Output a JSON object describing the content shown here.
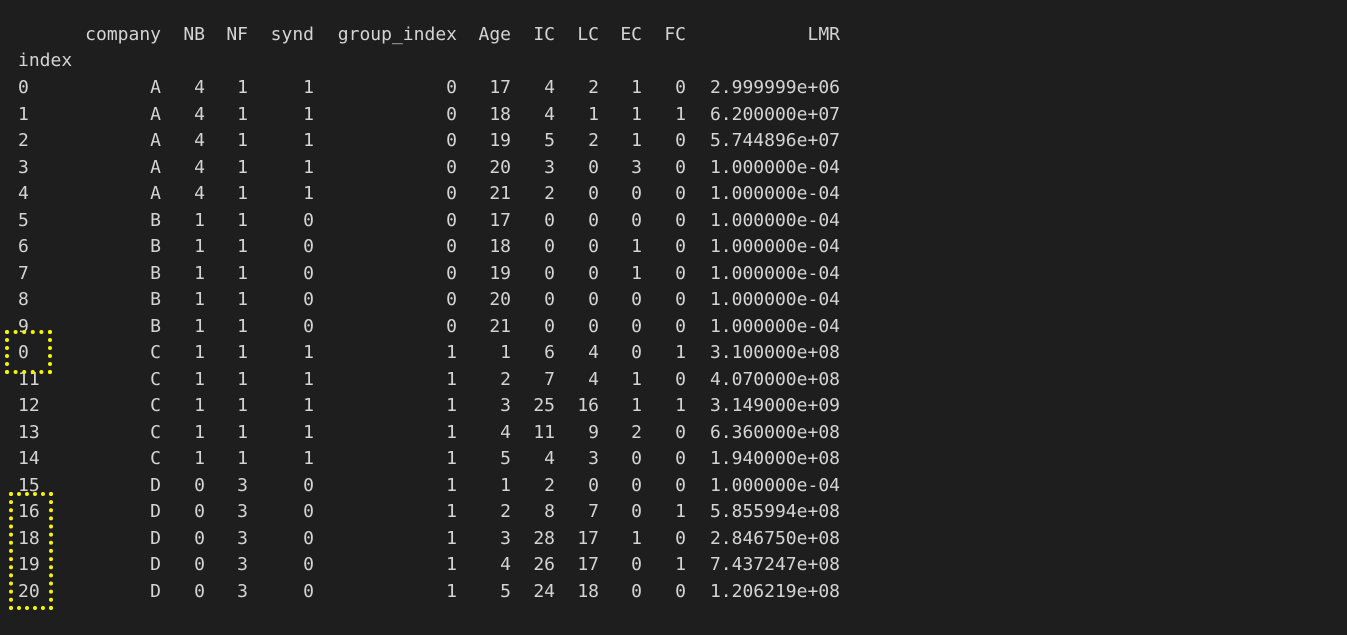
{
  "output": {
    "columns": [
      "company",
      "NB",
      "NF",
      "synd",
      "group_index",
      "Age",
      "IC",
      "LC",
      "EC",
      "FC",
      "LMR"
    ],
    "index_label": "index",
    "rows": [
      {
        "index": "0",
        "company": "A",
        "NB": "4",
        "NF": "1",
        "synd": "1",
        "group_index": "0",
        "Age": "17",
        "IC": "4",
        "LC": "2",
        "EC": "1",
        "FC": "0",
        "LMR": "2.999999e+06"
      },
      {
        "index": "1",
        "company": "A",
        "NB": "4",
        "NF": "1",
        "synd": "1",
        "group_index": "0",
        "Age": "18",
        "IC": "4",
        "LC": "1",
        "EC": "1",
        "FC": "1",
        "LMR": "6.200000e+07"
      },
      {
        "index": "2",
        "company": "A",
        "NB": "4",
        "NF": "1",
        "synd": "1",
        "group_index": "0",
        "Age": "19",
        "IC": "5",
        "LC": "2",
        "EC": "1",
        "FC": "0",
        "LMR": "5.744896e+07"
      },
      {
        "index": "3",
        "company": "A",
        "NB": "4",
        "NF": "1",
        "synd": "1",
        "group_index": "0",
        "Age": "20",
        "IC": "3",
        "LC": "0",
        "EC": "3",
        "FC": "0",
        "LMR": "1.000000e-04"
      },
      {
        "index": "4",
        "company": "A",
        "NB": "4",
        "NF": "1",
        "synd": "1",
        "group_index": "0",
        "Age": "21",
        "IC": "2",
        "LC": "0",
        "EC": "0",
        "FC": "0",
        "LMR": "1.000000e-04"
      },
      {
        "index": "5",
        "company": "B",
        "NB": "1",
        "NF": "1",
        "synd": "0",
        "group_index": "0",
        "Age": "17",
        "IC": "0",
        "LC": "0",
        "EC": "0",
        "FC": "0",
        "LMR": "1.000000e-04"
      },
      {
        "index": "6",
        "company": "B",
        "NB": "1",
        "NF": "1",
        "synd": "0",
        "group_index": "0",
        "Age": "18",
        "IC": "0",
        "LC": "0",
        "EC": "1",
        "FC": "0",
        "LMR": "1.000000e-04"
      },
      {
        "index": "7",
        "company": "B",
        "NB": "1",
        "NF": "1",
        "synd": "0",
        "group_index": "0",
        "Age": "19",
        "IC": "0",
        "LC": "0",
        "EC": "1",
        "FC": "0",
        "LMR": "1.000000e-04"
      },
      {
        "index": "8",
        "company": "B",
        "NB": "1",
        "NF": "1",
        "synd": "0",
        "group_index": "0",
        "Age": "20",
        "IC": "0",
        "LC": "0",
        "EC": "0",
        "FC": "0",
        "LMR": "1.000000e-04"
      },
      {
        "index": "9",
        "company": "B",
        "NB": "1",
        "NF": "1",
        "synd": "0",
        "group_index": "0",
        "Age": "21",
        "IC": "0",
        "LC": "0",
        "EC": "0",
        "FC": "0",
        "LMR": "1.000000e-04"
      },
      {
        "index": "0",
        "company": "C",
        "NB": "1",
        "NF": "1",
        "synd": "1",
        "group_index": "1",
        "Age": "1",
        "IC": "6",
        "LC": "4",
        "EC": "0",
        "FC": "1",
        "LMR": "3.100000e+08"
      },
      {
        "index": "11",
        "company": "C",
        "NB": "1",
        "NF": "1",
        "synd": "1",
        "group_index": "1",
        "Age": "2",
        "IC": "7",
        "LC": "4",
        "EC": "1",
        "FC": "0",
        "LMR": "4.070000e+08"
      },
      {
        "index": "12",
        "company": "C",
        "NB": "1",
        "NF": "1",
        "synd": "1",
        "group_index": "1",
        "Age": "3",
        "IC": "25",
        "LC": "16",
        "EC": "1",
        "FC": "1",
        "LMR": "3.149000e+09"
      },
      {
        "index": "13",
        "company": "C",
        "NB": "1",
        "NF": "1",
        "synd": "1",
        "group_index": "1",
        "Age": "4",
        "IC": "11",
        "LC": "9",
        "EC": "2",
        "FC": "0",
        "LMR": "6.360000e+08"
      },
      {
        "index": "14",
        "company": "C",
        "NB": "1",
        "NF": "1",
        "synd": "1",
        "group_index": "1",
        "Age": "5",
        "IC": "4",
        "LC": "3",
        "EC": "0",
        "FC": "0",
        "LMR": "1.940000e+08"
      },
      {
        "index": "15",
        "company": "D",
        "NB": "0",
        "NF": "3",
        "synd": "0",
        "group_index": "1",
        "Age": "1",
        "IC": "2",
        "LC": "0",
        "EC": "0",
        "FC": "0",
        "LMR": "1.000000e-04"
      },
      {
        "index": "16",
        "company": "D",
        "NB": "0",
        "NF": "3",
        "synd": "0",
        "group_index": "1",
        "Age": "2",
        "IC": "8",
        "LC": "7",
        "EC": "0",
        "FC": "1",
        "LMR": "5.855994e+08"
      },
      {
        "index": "18",
        "company": "D",
        "NB": "0",
        "NF": "3",
        "synd": "0",
        "group_index": "1",
        "Age": "3",
        "IC": "28",
        "LC": "17",
        "EC": "1",
        "FC": "0",
        "LMR": "2.846750e+08"
      },
      {
        "index": "19",
        "company": "D",
        "NB": "0",
        "NF": "3",
        "synd": "0",
        "group_index": "1",
        "Age": "4",
        "IC": "26",
        "LC": "17",
        "EC": "0",
        "FC": "1",
        "LMR": "7.437247e+08"
      },
      {
        "index": "20",
        "company": "D",
        "NB": "0",
        "NF": "3",
        "synd": "0",
        "group_index": "1",
        "Age": "5",
        "IC": "24",
        "LC": "18",
        "EC": "0",
        "FC": "0",
        "LMR": "1.206219e+08"
      }
    ]
  },
  "highlights": {
    "color": "#f4f400"
  },
  "colors": {
    "background": "#1e1e1e",
    "text": "#d4d4d4"
  }
}
